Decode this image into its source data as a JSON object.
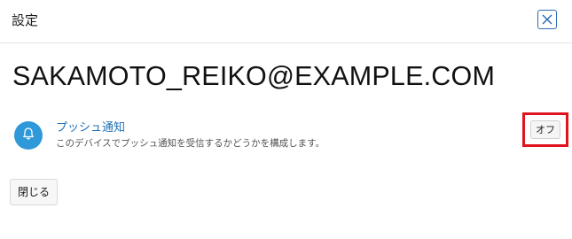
{
  "dialog": {
    "title": "設定",
    "close_icon": "close-icon"
  },
  "account": {
    "email": "SAKAMOTO_REIKO@EXAMPLE.COM"
  },
  "setting": {
    "icon": "bell-icon",
    "title": "プッシュ通知",
    "description": "このデバイスでプッシュ通知を受信するかどうかを構成します。",
    "toggle_label": "オフ"
  },
  "footer": {
    "close_label": "閉じる"
  },
  "colors": {
    "accent": "#1f6fb5",
    "icon_bg": "#2f98d9",
    "highlight": "#e0141e"
  }
}
